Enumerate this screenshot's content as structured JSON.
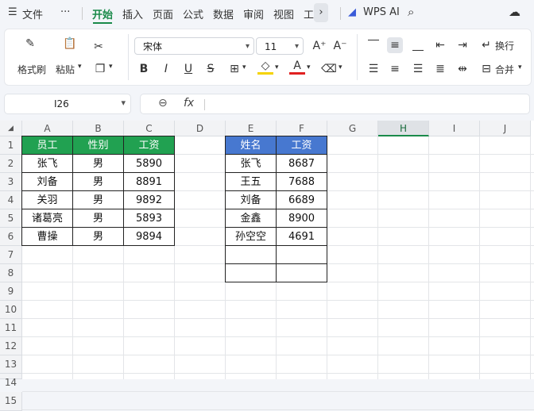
{
  "menubar": {
    "file_icon": "hamburger-icon",
    "file": "文件",
    "more": "···",
    "tabs": [
      "开始",
      "插入",
      "页面",
      "公式",
      "数据",
      "审阅",
      "视图",
      "工"
    ],
    "active_tab": "开始",
    "wps_ai": "WPS AI"
  },
  "ribbon": {
    "format_painter": "格式刷",
    "paste": "粘贴",
    "font_name": "宋体",
    "font_size": "11",
    "wrap": "换行",
    "merge": "合并"
  },
  "formula_bar": {
    "cell_ref": "I26",
    "fx": "fx",
    "value": ""
  },
  "sheet": {
    "columns": [
      "A",
      "B",
      "C",
      "D",
      "E",
      "F",
      "G",
      "H",
      "I",
      "J"
    ],
    "selected_column": "H",
    "rows": [
      "1",
      "2",
      "3",
      "4",
      "5",
      "6",
      "7",
      "8",
      "9",
      "10",
      "11",
      "12",
      "13",
      "14",
      "15"
    ],
    "table1": {
      "headers": [
        "员工",
        "性别",
        "工资"
      ],
      "rows": [
        [
          "张飞",
          "男",
          "5890"
        ],
        [
          "刘备",
          "男",
          "8891"
        ],
        [
          "关羽",
          "男",
          "9892"
        ],
        [
          "诸葛亮",
          "男",
          "5893"
        ],
        [
          "曹操",
          "男",
          "9894"
        ]
      ]
    },
    "table2": {
      "headers": [
        "姓名",
        "工资"
      ],
      "rows": [
        [
          "张飞",
          "8687"
        ],
        [
          "王五",
          "7688"
        ],
        [
          "刘备",
          "6689"
        ],
        [
          "金鑫",
          "8900"
        ],
        [
          "孙空空",
          "4691"
        ],
        [
          "",
          ""
        ],
        [
          "",
          ""
        ]
      ]
    },
    "colors": {
      "green_header": "#21a151",
      "blue_header": "#4778d0",
      "accent": "#1a8a4a"
    }
  }
}
